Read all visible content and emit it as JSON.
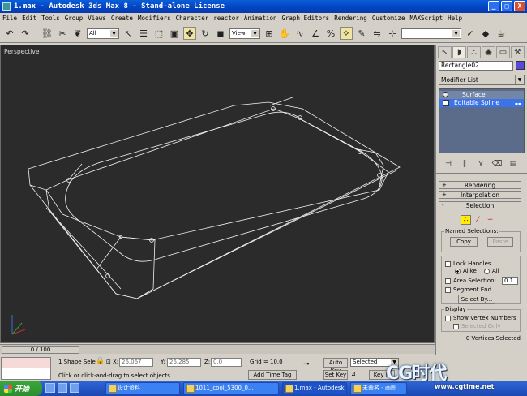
{
  "window": {
    "title": "1.max - Autodesk 3ds Max 8  - Stand-alone License",
    "buttons": [
      "_",
      "□",
      "X"
    ]
  },
  "menu": [
    "File",
    "Edit",
    "Tools",
    "Group",
    "Views",
    "Create",
    "Modifiers",
    "Character",
    "reactor",
    "Animation",
    "Graph Editors",
    "Rendering",
    "Customize",
    "MAXScript",
    "Help"
  ],
  "toolbar": {
    "selection_filter": "All",
    "ref_coord": "View",
    "named_selection": ""
  },
  "viewport": {
    "label": "Perspective"
  },
  "command_panel": {
    "object_name": "Rectangle02",
    "object_color": "#5a48d8",
    "modifier_list": "Modifier List",
    "stack": [
      "Surface",
      "Editable Spline"
    ],
    "rollouts": {
      "rendering": "Rendering",
      "interpolation": "Interpolation",
      "selection": "Selection"
    },
    "named_selections": {
      "title": "Named Selections:",
      "copy": "Copy",
      "paste": "Paste"
    },
    "lock_handles": "Lock Handles",
    "alike": "Alike",
    "all": "All",
    "area_selection": "Area Selection:",
    "area_value": "0.1",
    "segment_end": "Segment End",
    "select_by": "Select By...",
    "display_title": "Display",
    "show_vertex_numbers": "Show Vertex Numbers",
    "selected_only": "Selected Only",
    "status": "0 Vertices Selected"
  },
  "timeslider": {
    "position": "0 / 100"
  },
  "status": {
    "shape_selected": "1 Shape Sele",
    "prompt": "Click or click-and-drag to select objects",
    "x_label": "X:",
    "x_value": "26.067",
    "y_label": "Y:",
    "y_value": "26.285",
    "z_label": "Z:",
    "z_value": "0.0",
    "grid": "Grid = 10.0",
    "add_time_tag": "Add Time Tag",
    "auto_key": "Auto Key",
    "selected": "Selected",
    "set_key": "Set Key",
    "key_filters": "Key Fi"
  },
  "taskbar": {
    "start": "开始",
    "tasks": [
      "设计资料",
      "1011_cool_5300_0...",
      "1.max - Autodesk ...",
      "未命名 - 画图"
    ]
  },
  "watermark": {
    "logo": "CG时代",
    "url": "www.cgtime.net"
  }
}
